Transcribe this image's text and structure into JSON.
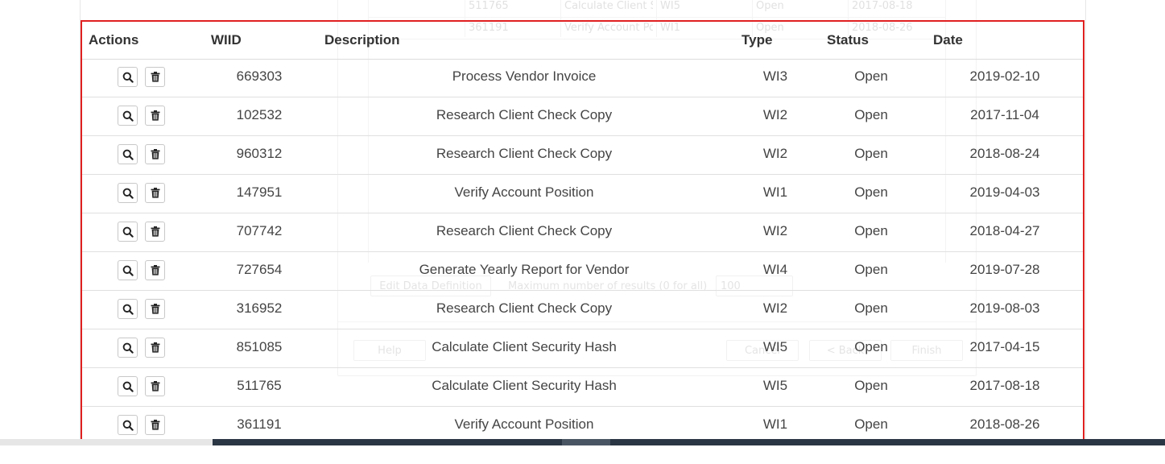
{
  "ghost_dialog": {
    "rows": [
      {
        "id": "511765",
        "description": "Calculate Client S",
        "type": "WI5",
        "status": "Open",
        "date": "2017-08-18"
      },
      {
        "id": "361191",
        "description": "Verify Account Po",
        "type": "WI1",
        "status": "Open",
        "date": "2018-08-26"
      }
    ],
    "edit_data_definition_label": "Edit Data Definition",
    "max_results_label": "Maximum number of results (0 for all)",
    "max_results_value": "100",
    "help_label": "Help",
    "cancel_label": "Cancel",
    "back_label": "< Back",
    "finish_label": "Finish"
  },
  "table": {
    "headers": {
      "actions": "Actions",
      "wiid": "WIID",
      "description": "Description",
      "type": "Type",
      "status": "Status",
      "date": "Date"
    },
    "action_icons": [
      "search-icon",
      "trash-icon"
    ],
    "rows": [
      {
        "wiid": "669303",
        "description": "Process Vendor Invoice",
        "type": "WI3",
        "status": "Open",
        "date": "2019-02-10"
      },
      {
        "wiid": "102532",
        "description": "Research Client Check Copy",
        "type": "WI2",
        "status": "Open",
        "date": "2017-11-04"
      },
      {
        "wiid": "960312",
        "description": "Research Client Check Copy",
        "type": "WI2",
        "status": "Open",
        "date": "2018-08-24"
      },
      {
        "wiid": "147951",
        "description": "Verify Account Position",
        "type": "WI1",
        "status": "Open",
        "date": "2019-04-03"
      },
      {
        "wiid": "707742",
        "description": "Research Client Check Copy",
        "type": "WI2",
        "status": "Open",
        "date": "2018-04-27"
      },
      {
        "wiid": "727654",
        "description": "Generate Yearly Report for Vendor",
        "type": "WI4",
        "status": "Open",
        "date": "2019-07-28"
      },
      {
        "wiid": "316952",
        "description": "Research Client Check Copy",
        "type": "WI2",
        "status": "Open",
        "date": "2019-08-03"
      },
      {
        "wiid": "851085",
        "description": "Calculate Client Security Hash",
        "type": "WI5",
        "status": "Open",
        "date": "2017-04-15"
      },
      {
        "wiid": "511765",
        "description": "Calculate Client Security Hash",
        "type": "WI5",
        "status": "Open",
        "date": "2017-08-18"
      },
      {
        "wiid": "361191",
        "description": "Verify Account Position",
        "type": "WI1",
        "status": "Open",
        "date": "2018-08-26"
      }
    ]
  },
  "colors": {
    "table_border": "#e02020",
    "scrollbar_thumb": "#2b3644"
  }
}
